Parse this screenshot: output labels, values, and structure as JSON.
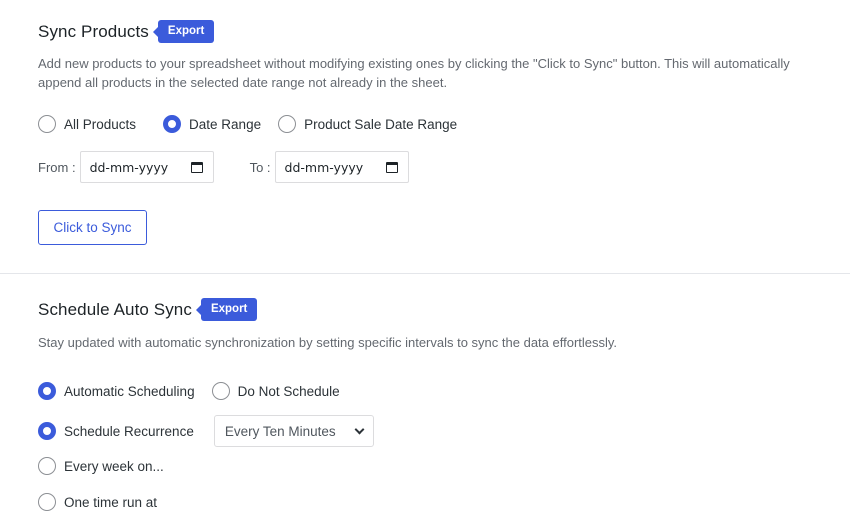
{
  "sync_products": {
    "title": "Sync Products",
    "badge": "Export",
    "description": "Add new products to your spreadsheet without modifying existing ones by clicking the \"Click to Sync\" button. This will automatically append all products in the selected date range not already in the sheet.",
    "options": [
      {
        "label": "All Products",
        "checked": false
      },
      {
        "label": "Date Range",
        "checked": true
      },
      {
        "label": "Product Sale Date Range",
        "checked": false
      }
    ],
    "from_label": "From :",
    "from_placeholder": "dd-mm-yyyy",
    "to_label": "To :",
    "to_placeholder": "dd-mm-yyyy",
    "sync_button": "Click to Sync"
  },
  "schedule_auto_sync": {
    "title": "Schedule Auto Sync",
    "badge": "Export",
    "description": "Stay updated with automatic synchronization by setting specific intervals to sync the data effortlessly.",
    "mode_options": [
      {
        "label": "Automatic Scheduling",
        "checked": true
      },
      {
        "label": "Do Not Schedule",
        "checked": false
      }
    ],
    "recurrence_options": [
      {
        "label": "Schedule Recurrence",
        "checked": true
      },
      {
        "label": "Every week on...",
        "checked": false
      },
      {
        "label": "One time run at",
        "checked": false
      }
    ],
    "recurrence_select_value": "Every Ten Minutes"
  },
  "colors": {
    "accent": "#3b5bdb",
    "text": "#1d2327",
    "muted": "#646970",
    "border": "#dcdcde"
  },
  "icons": [
    "calendar-icon",
    "chevron-down-icon"
  ]
}
